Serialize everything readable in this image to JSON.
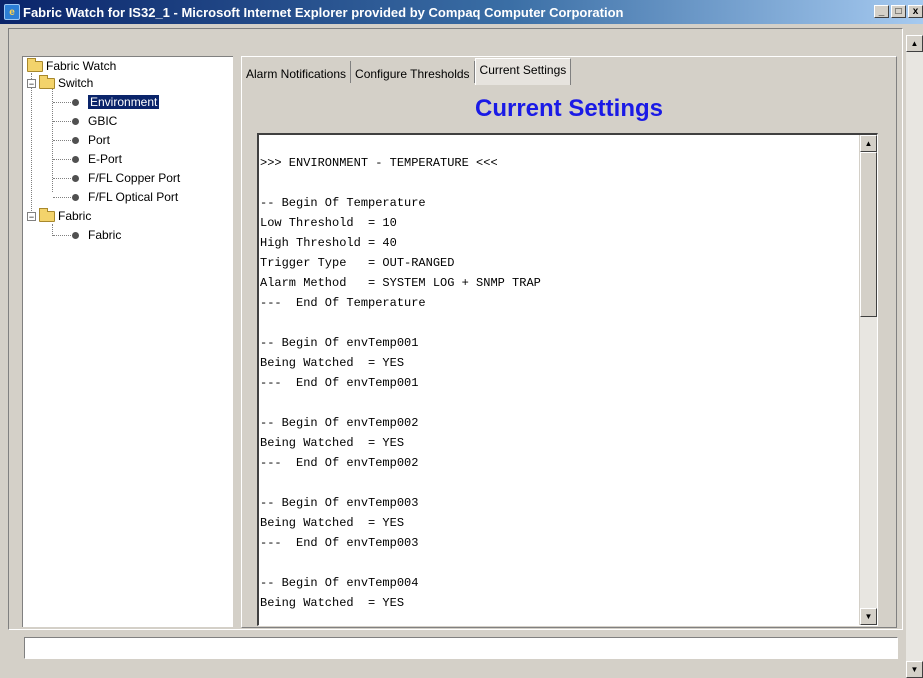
{
  "window": {
    "title": "Fabric Watch for IS32_1 - Microsoft Internet Explorer provided by Compaq Computer Corporation",
    "icon": "ie-icon",
    "minimize_label": "_",
    "maximize_label": "□",
    "close_label": "x"
  },
  "tree": {
    "root": "Fabric Watch",
    "switch": {
      "label": "Switch",
      "expander": "−",
      "items": [
        "Environment",
        "GBIC",
        "Port",
        "E-Port",
        "F/FL Copper Port",
        "F/FL Optical Port"
      ],
      "selected": "Environment"
    },
    "fabric": {
      "label": "Fabric",
      "expander": "−",
      "items": [
        "Fabric"
      ]
    }
  },
  "tabs": [
    {
      "label": "Alarm Notifications",
      "active": false
    },
    {
      "label": "Configure Thresholds",
      "active": false
    },
    {
      "label": "Current Settings",
      "active": true
    }
  ],
  "page_title": "Current Settings",
  "settings_text": [
    ">>> ENVIRONMENT - TEMPERATURE <<<",
    "",
    "-- Begin Of Temperature",
    "Low Threshold  = 10",
    "High Threshold = 40",
    "Trigger Type   = OUT-RANGED",
    "Alarm Method   = SYSTEM LOG + SNMP TRAP",
    "---  End Of Temperature",
    "",
    "-- Begin Of envTemp001",
    "Being Watched  = YES",
    "---  End Of envTemp001",
    "",
    "-- Begin Of envTemp002",
    "Being Watched  = YES",
    "---  End Of envTemp002",
    "",
    "-- Begin Of envTemp003",
    "Being Watched  = YES",
    "---  End Of envTemp003",
    "",
    "-- Begin Of envTemp004",
    "Being Watched  = YES"
  ],
  "scroll": {
    "up_arrow": "▲",
    "down_arrow": "▼"
  },
  "status_bar_text": ""
}
